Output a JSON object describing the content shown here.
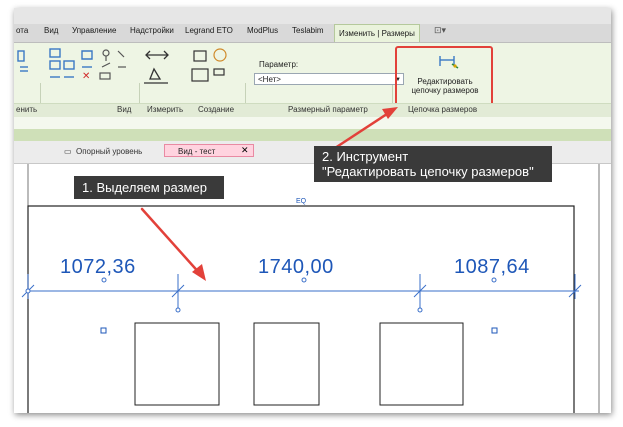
{
  "ribbon": {
    "tabs": [
      "ота",
      "Вид",
      "Управление",
      "Надстройки",
      "Legrand ETO",
      "ModPlus",
      "Teslabim"
    ],
    "active_tab": "Изменить | Размеры",
    "groups": {
      "left_fragment": "енить",
      "view": "Вид",
      "measure": "Измерить",
      "create": "Создание",
      "dimension_param": "Размерный параметр",
      "dimension_chain": "Цепочка размеров"
    },
    "parameter_label": "Параметр:",
    "parameter_value": "<Нет>",
    "edit_button_label": "Редактировать цепочку размеров"
  },
  "view_tabs": {
    "level_tab": "Опорный уровень",
    "active_tab": "Вид - тест",
    "close_symbol": "✕"
  },
  "drawing": {
    "dimensions": [
      "1072,36",
      "1740,00",
      "1087,64"
    ],
    "eq_label": "EQ"
  },
  "callouts": {
    "step1": "1. Выделяем размер",
    "step2_line1": "2. Инструмент",
    "step2_line2": "\"Редактировать цепочку размеров\""
  },
  "colors": {
    "highlight": "#e2413a",
    "dimension": "#1e57b8",
    "ribbon_bg": "#eef5e4",
    "active_view_tab": "#ffd3df"
  }
}
